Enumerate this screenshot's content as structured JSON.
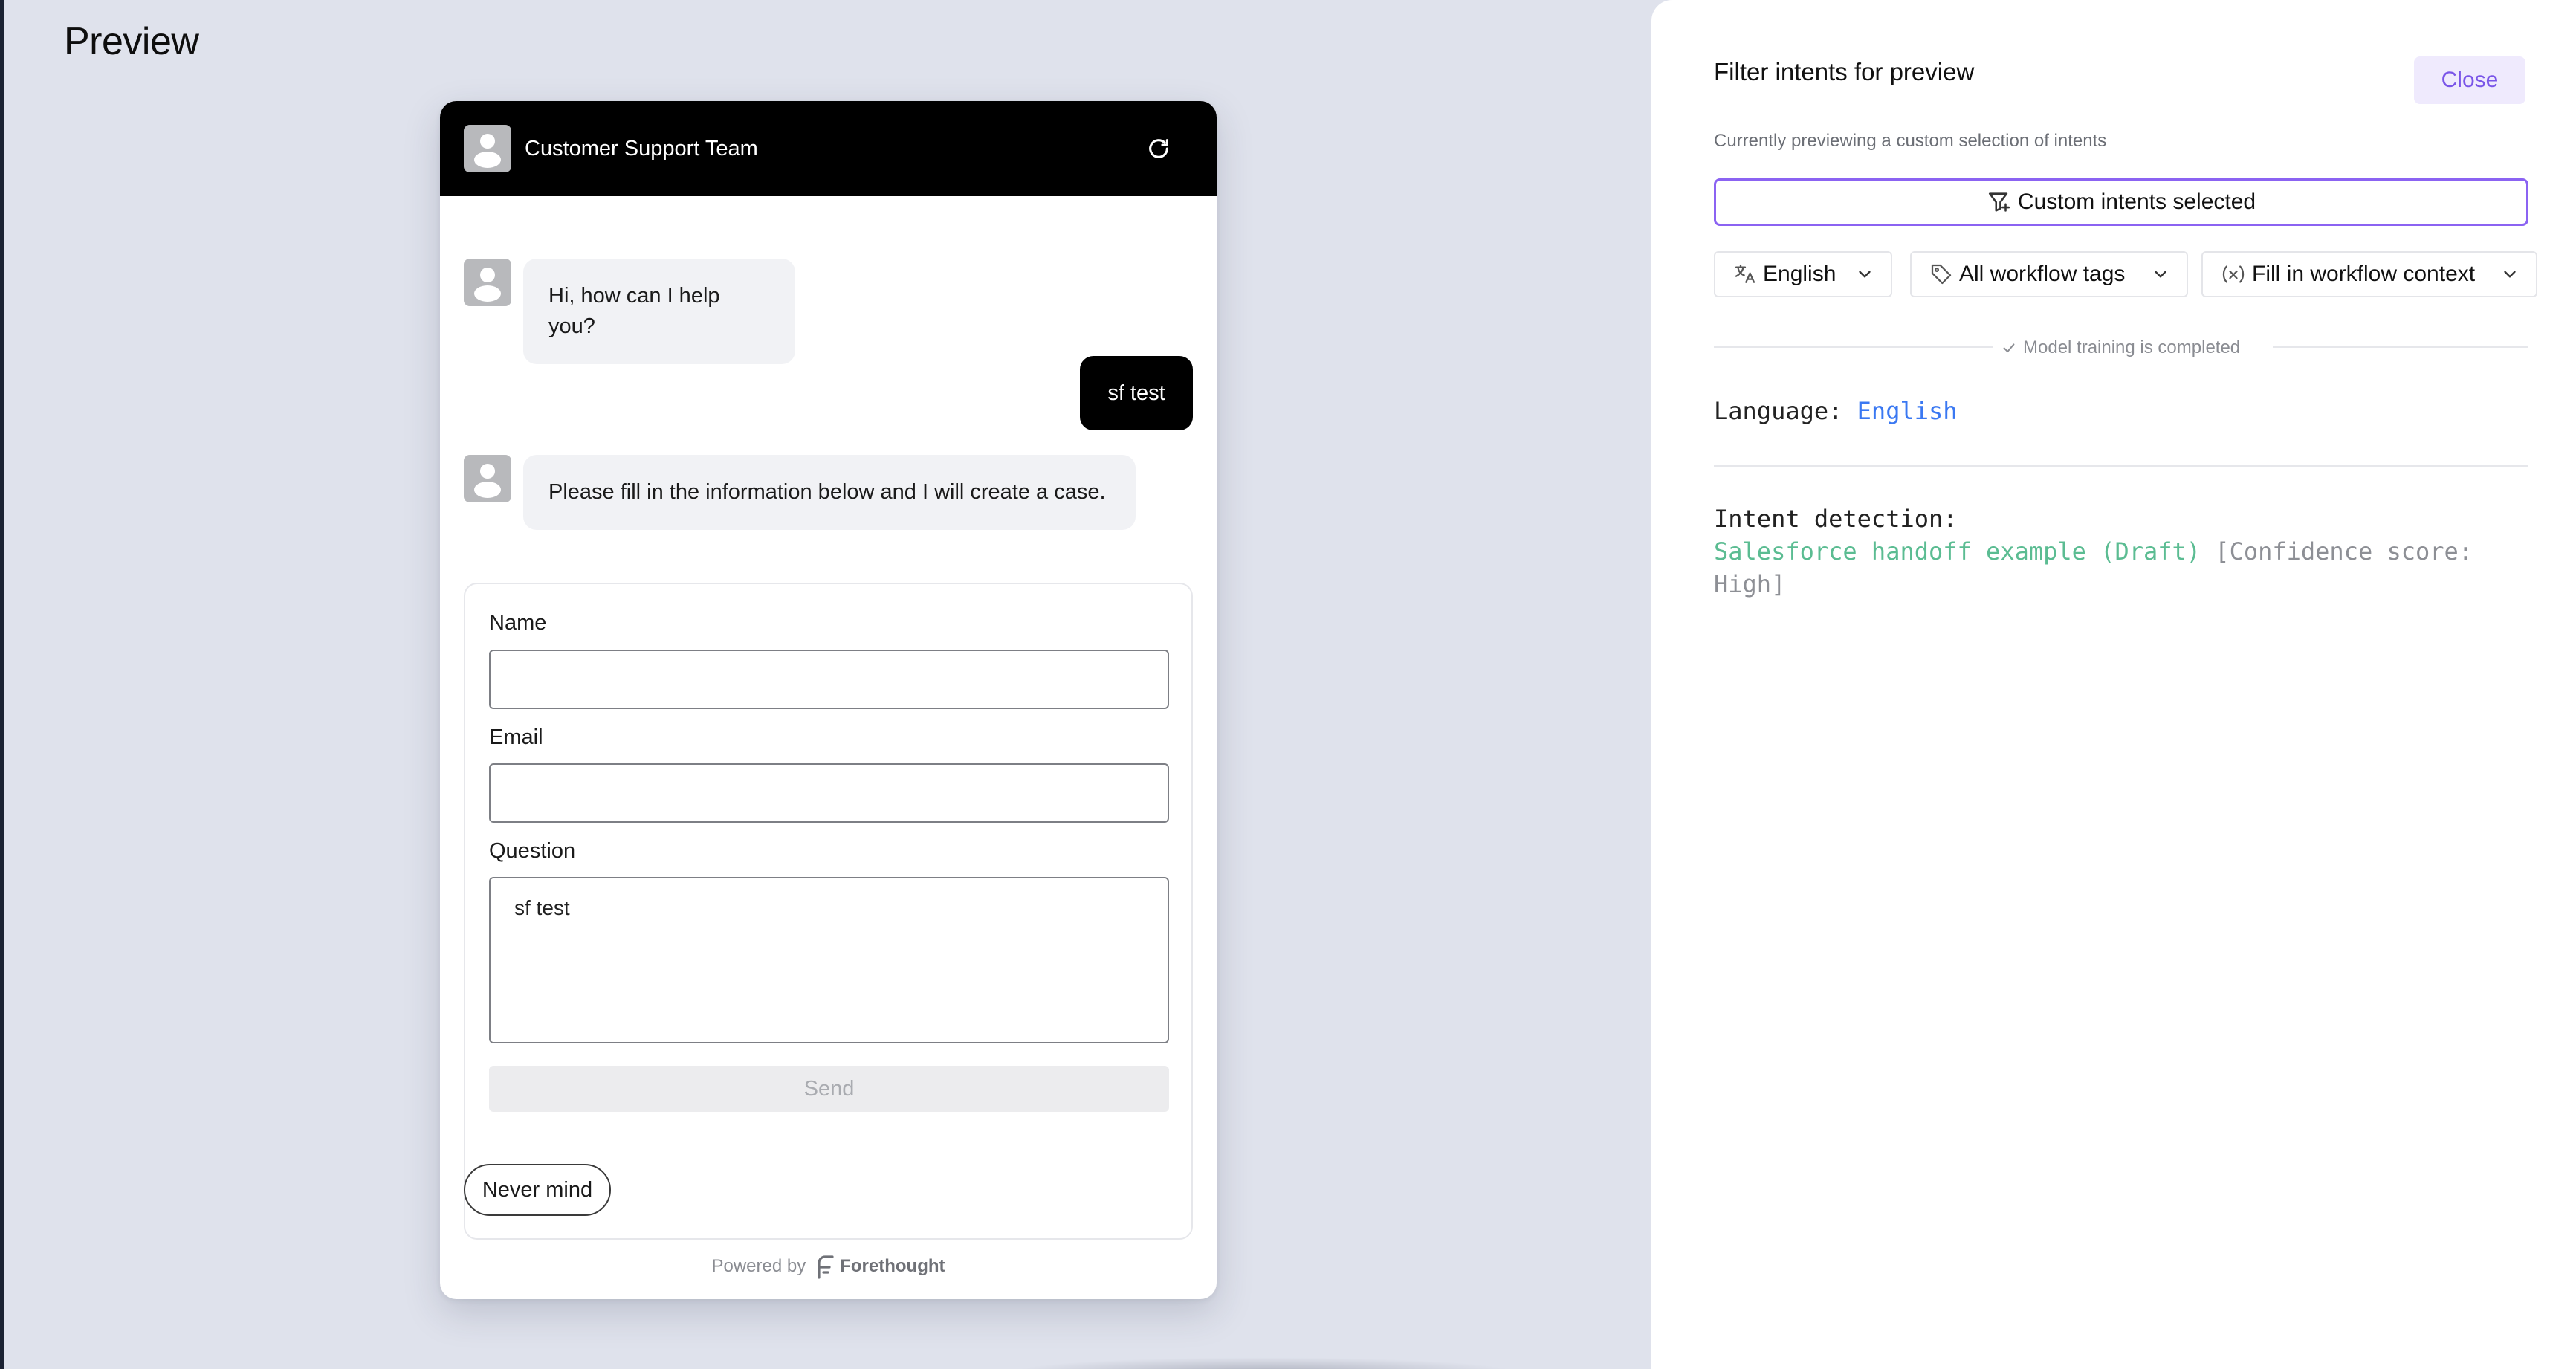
{
  "page": {
    "title": "Preview"
  },
  "widget": {
    "header_title": "Customer Support Team",
    "messages": [
      {
        "from": "bot",
        "text": "Hi, how can I help you?"
      },
      {
        "from": "user",
        "text": "sf test"
      },
      {
        "from": "bot",
        "text": "Please fill in the information below and I will create a case."
      }
    ],
    "form": {
      "name_label": "Name",
      "name_value": "",
      "email_label": "Email",
      "email_value": "",
      "question_label": "Question",
      "question_value": "sf test",
      "send_label": "Send"
    },
    "never_mind_label": "Never mind",
    "powered_by": "Powered by",
    "brand": "Forethought"
  },
  "panel": {
    "title": "Filter intents for preview",
    "close_label": "Close",
    "subtitle": "Currently previewing a custom selection of intents",
    "custom_select_label": "Custom intents selected",
    "language_dropdown": "English",
    "tags_dropdown": "All workflow tags",
    "context_dropdown": "Fill in workflow context",
    "training_status": "Model training is completed",
    "language_key": "Language:",
    "language_value": "English",
    "intent_key": "Intent detection:",
    "intent_name": "Salesforce handoff example (Draft)",
    "intent_confidence": "[Confidence score: High]"
  },
  "colors": {
    "accent": "#8b63f2",
    "language_value": "#3a78f2",
    "intent_name": "#5bbc92",
    "header_bg": "#000000"
  }
}
